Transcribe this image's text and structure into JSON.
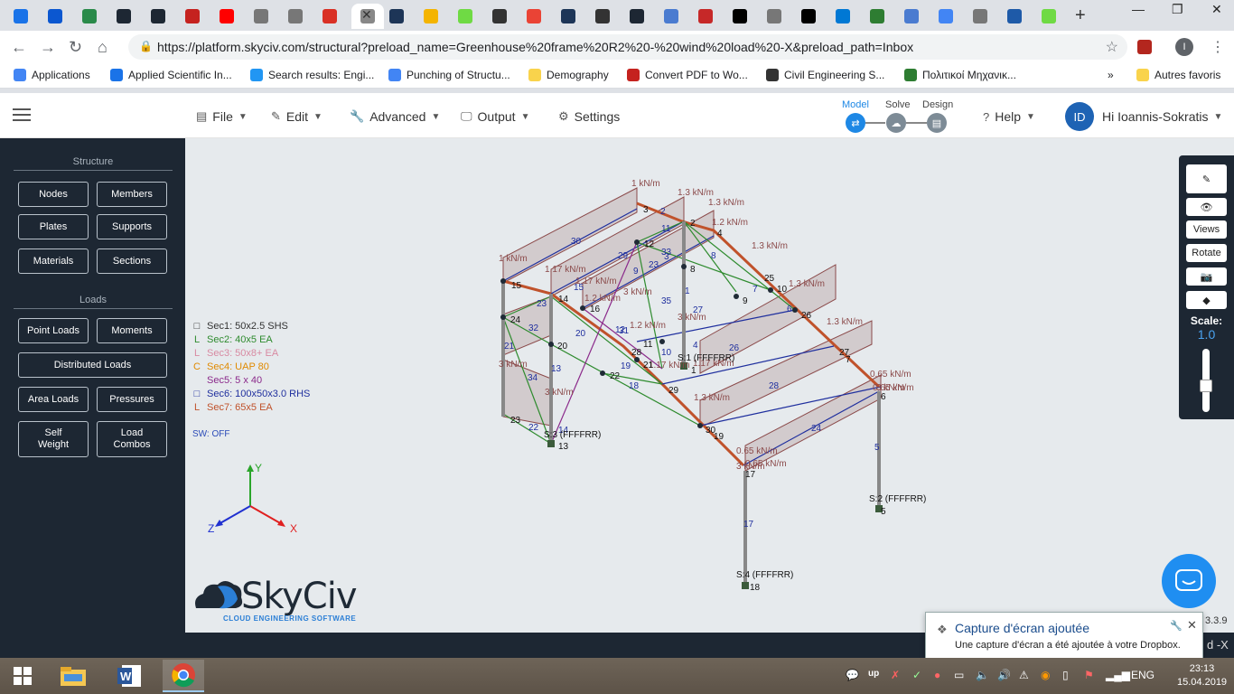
{
  "browser": {
    "tabs": [
      {
        "icon": "skyciv-icon",
        "color": "#1a73e8"
      },
      {
        "icon": "app-icon",
        "color": "#0b57d0"
      },
      {
        "icon": "globe-icon",
        "color": "#2a8a4a"
      },
      {
        "icon": "cloud-icon",
        "color": "#1d2733"
      },
      {
        "icon": "cloud-icon",
        "color": "#1d2733"
      },
      {
        "icon": "pdf-icon",
        "color": "#c5221f"
      },
      {
        "icon": "youtube-icon",
        "color": "#ff0000"
      },
      {
        "icon": "file-icon",
        "color": "#777777"
      },
      {
        "icon": "file-icon",
        "color": "#777777"
      },
      {
        "icon": "gmail-icon",
        "color": "#d93025"
      },
      {
        "icon": "loading-icon",
        "color": "#888888",
        "active": true
      },
      {
        "icon": "l-icon",
        "color": "#1d3557"
      },
      {
        "icon": "drive-icon",
        "color": "#f4b400"
      },
      {
        "icon": "upwork-icon",
        "color": "#6fda44"
      },
      {
        "icon": "satellite-icon",
        "color": "#333333"
      },
      {
        "icon": "photos-icon",
        "color": "#ea4335"
      },
      {
        "icon": "l-icon",
        "color": "#1d3557"
      },
      {
        "icon": "satellite-icon",
        "color": "#333333"
      },
      {
        "icon": "cloud-icon",
        "color": "#1d2733"
      },
      {
        "icon": "shape-icon",
        "color": "#4a7bd0"
      },
      {
        "icon": "shield-icon",
        "color": "#c62828"
      },
      {
        "icon": "w-icon",
        "color": "#000000"
      },
      {
        "icon": "file-icon",
        "color": "#777777"
      },
      {
        "icon": "z-icon",
        "color": "#000000"
      },
      {
        "icon": "outlook-icon",
        "color": "#0078d4"
      },
      {
        "icon": "book-icon",
        "color": "#2e7d32"
      },
      {
        "icon": "shape-icon",
        "color": "#4a7bd0"
      },
      {
        "icon": "google-icon",
        "color": "#4285f4"
      },
      {
        "icon": "file-icon",
        "color": "#777777"
      },
      {
        "icon": "pq-icon",
        "color": "#1e5aa8"
      },
      {
        "icon": "upwork-icon",
        "color": "#6fda44"
      }
    ],
    "url": "https://platform.skyciv.com/structural?preload_name=Greenhouse%20frame%20R2%20-%20wind%20load%20-X&preload_path=Inbox",
    "bookmarks": [
      {
        "label": "Applications",
        "color": "#4285f4"
      },
      {
        "label": "Applied Scientific In...",
        "color": "#1a73e8"
      },
      {
        "label": "Search results: Engi...",
        "color": "#2196f3"
      },
      {
        "label": "Punching of Structu...",
        "color": "#4285f4"
      },
      {
        "label": "Demography",
        "color": "#f9d34c"
      },
      {
        "label": "Convert PDF to Wo...",
        "color": "#c5221f"
      },
      {
        "label": "Civil Engineering S...",
        "color": "#333333"
      },
      {
        "label": "Πολιτικοί Μηχανικ...",
        "color": "#2e7d32"
      },
      {
        "label": "Autres favoris",
        "color": "#f9d34c"
      }
    ],
    "profile_initial": "I"
  },
  "header": {
    "menu": [
      {
        "label": "File",
        "icon": "file-icon"
      },
      {
        "label": "Edit",
        "icon": "pencil-icon"
      },
      {
        "label": "Advanced",
        "icon": "wrench-icon"
      },
      {
        "label": "Output",
        "icon": "monitor-icon"
      },
      {
        "label": "Settings",
        "icon": "gear-icon"
      }
    ],
    "steps": [
      {
        "label": "Model",
        "active": true
      },
      {
        "label": "Solve",
        "active": false
      },
      {
        "label": "Design",
        "active": false
      }
    ],
    "help": "Help",
    "user_initials": "ID",
    "user_greeting": "Hi Ioannis-Sokratis"
  },
  "sidebar": {
    "structure_title": "Structure",
    "structure_buttons": [
      "Nodes",
      "Members",
      "Plates",
      "Supports",
      "Materials",
      "Sections"
    ],
    "loads_title": "Loads",
    "point_loads": "Point Loads",
    "moments": "Moments",
    "distributed_loads": "Distributed Loads",
    "area_loads": "Area Loads",
    "pressures": "Pressures",
    "self_weight": "Self\nWeight",
    "load_combos": "Load\nCombos"
  },
  "legend": [
    {
      "mark": "□",
      "label": "Sec1: 50x2.5 SHS",
      "color": "#333333"
    },
    {
      "mark": "L",
      "label": "Sec2: 40x5 EA",
      "color": "#2e8b2e"
    },
    {
      "mark": "L",
      "label": "Sec3: 50x8+ EA",
      "color": "#d88aa2"
    },
    {
      "mark": "C",
      "label": "Sec4: UAP 80",
      "color": "#e08a00"
    },
    {
      "mark": "",
      "label": "Sec5: 5 x 40",
      "color": "#8b2a8b"
    },
    {
      "mark": "□",
      "label": "Sec6: 100x50x3.0 RHS",
      "color": "#1f2f9e"
    },
    {
      "mark": "L",
      "label": "Sec7: 65x5 EA",
      "color": "#c0522b"
    }
  ],
  "sw_status": "SW: OFF",
  "axes": {
    "x": "X",
    "y": "Y",
    "z": "Z"
  },
  "logo": {
    "word": "SkyCiv",
    "tagline": "CLOUD ENGINEERING SOFTWARE"
  },
  "right_tools": {
    "views": "Views",
    "rotate": "Rotate",
    "scale_label": "Scale:",
    "scale_value": "1.0"
  },
  "version_fragment": "3.3.9",
  "title_fragment": "d -X",
  "model": {
    "load_labels": [
      "1 kN/m",
      "1.3 kN/m",
      "1.3 kN/m",
      "1.2 kN/m",
      "1.3 kN/m",
      "1.3 kN/m",
      "1.3 kN/m",
      "1 kN/m",
      "1.17 kN/m",
      "1.17 kN/m",
      "1.2 kN/m",
      "1.2 kN/m",
      "3 kN/m",
      "3 kN/m",
      "1.17 kN/m",
      "1.17 kN/m",
      "3 kN/m",
      "3 kN/m",
      "1.3 kN/m",
      "0.65 kN/m",
      "0.65 kN/m",
      "0.65 kN/m",
      "0.65 kN/m",
      "3 kN/m",
      "3 kN/m"
    ],
    "support_labels": [
      "S:1 (FFFFRR)",
      "S:3 (FFFFRR)",
      "S:2 (FFFFRR)",
      "S:4 (FFFFRR)"
    ],
    "node_labels": [
      "3",
      "2",
      "4",
      "12",
      "8",
      "25",
      "10",
      "26",
      "27",
      "7",
      "6",
      "5",
      "15",
      "14",
      "16",
      "24",
      "20",
      "28",
      "11",
      "1",
      "21",
      "22",
      "29",
      "30",
      "19",
      "23",
      "13",
      "9",
      "17",
      "18"
    ],
    "member_labels": [
      "30",
      "2",
      "11",
      "29",
      "33",
      "23",
      "9",
      "8",
      "35",
      "1",
      "7",
      "6",
      "27",
      "14",
      "23",
      "32",
      "20",
      "21",
      "13",
      "34",
      "22",
      "12",
      "10",
      "26",
      "19",
      "18",
      "28",
      "24",
      "5",
      "17",
      "3",
      "4",
      "15",
      "31"
    ]
  },
  "notification": {
    "title": "Capture d'écran ajoutée",
    "body": "Une capture d'écran a été ajoutée à votre Dropbox."
  },
  "taskbar": {
    "apps": [
      {
        "icon": "windows-start-icon"
      },
      {
        "icon": "file-explorer-icon"
      },
      {
        "icon": "word-icon"
      },
      {
        "icon": "chrome-icon",
        "active": true
      }
    ],
    "lang": "ENG",
    "time": "23:13",
    "date": "15.04.2019"
  }
}
